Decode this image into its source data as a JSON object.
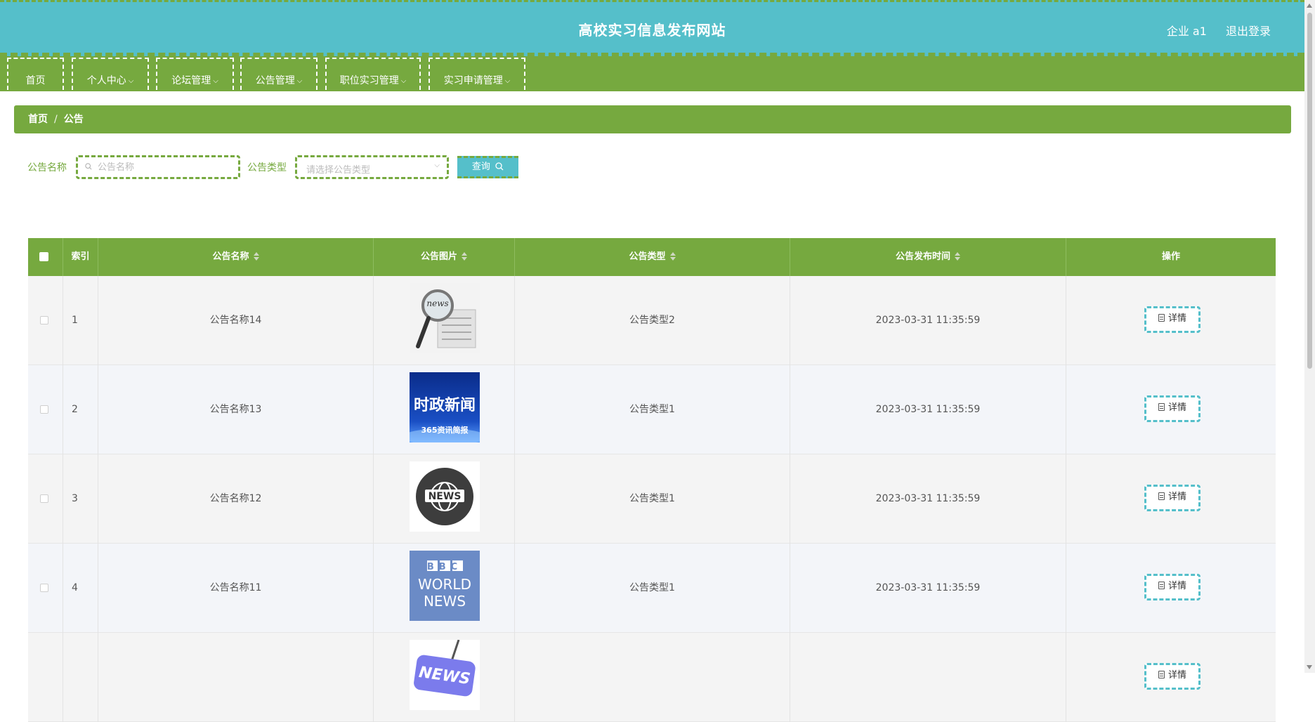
{
  "header": {
    "title": "高校实习信息发布网站",
    "user_label": "企业 a1",
    "logout_label": "退出登录"
  },
  "nav": {
    "items": [
      {
        "label": "首页",
        "has_dropdown": false
      },
      {
        "label": "个人中心",
        "has_dropdown": true
      },
      {
        "label": "论坛管理",
        "has_dropdown": true
      },
      {
        "label": "公告管理",
        "has_dropdown": true
      },
      {
        "label": "职位实习管理",
        "has_dropdown": true
      },
      {
        "label": "实习申请管理",
        "has_dropdown": true
      }
    ]
  },
  "breadcrumb": {
    "home": "首页",
    "separator": "/",
    "current": "公告"
  },
  "search": {
    "name_label": "公告名称",
    "name_placeholder": "公告名称",
    "type_label": "公告类型",
    "type_placeholder": "请选择公告类型",
    "query_label": "查询"
  },
  "table": {
    "columns": {
      "index": "索引",
      "name": "公告名称",
      "image": "公告图片",
      "type": "公告类型",
      "time": "公告发布时间",
      "action": "操作"
    },
    "detail_label": "详情",
    "rows": [
      {
        "index": "1",
        "name": "公告名称14",
        "type": "公告类型2",
        "time": "2023-03-31 11:35:59",
        "image_text": "news"
      },
      {
        "index": "2",
        "name": "公告名称13",
        "type": "公告类型1",
        "time": "2023-03-31 11:35:59",
        "image_text": "时政新闻",
        "image_subtext": "365资讯简报"
      },
      {
        "index": "3",
        "name": "公告名称12",
        "type": "公告类型1",
        "time": "2023-03-31 11:35:59",
        "image_text": "NEWS"
      },
      {
        "index": "4",
        "name": "公告名称11",
        "type": "公告类型1",
        "time": "2023-03-31 11:35:59",
        "image_text": "BBC",
        "image_subtext": "WORLD",
        "image_subtext2": "NEWS"
      },
      {
        "index": "",
        "name": "",
        "type": "",
        "time": "",
        "image_text": "NEWS"
      }
    ]
  },
  "colors": {
    "primary_green": "#76a93f",
    "teal": "#55bfca"
  }
}
